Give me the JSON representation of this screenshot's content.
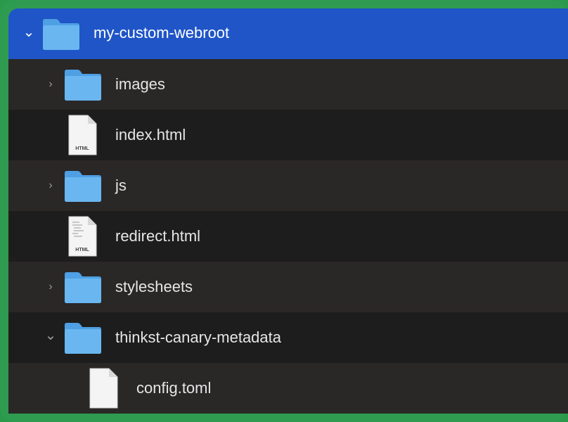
{
  "colors": {
    "frame": "#2f9b50",
    "panel": "#1e1d1d",
    "stripe": "#2a2727",
    "selected": "#1f55c7",
    "folder": "#5aa8e8",
    "text": "#e6e6e6"
  },
  "tree": {
    "root": {
      "name": "my-custom-webroot",
      "expanded": true,
      "selected": true,
      "icon": "folder-icon"
    },
    "items": [
      {
        "name": "images",
        "type": "folder",
        "icon": "folder-icon",
        "expanded": false
      },
      {
        "name": "index.html",
        "type": "file",
        "icon": "html-file-icon",
        "badge": "HTML"
      },
      {
        "name": "js",
        "type": "folder",
        "icon": "folder-icon",
        "expanded": false
      },
      {
        "name": "redirect.html",
        "type": "file",
        "icon": "html-file-icon",
        "badge": "HTML"
      },
      {
        "name": "stylesheets",
        "type": "folder",
        "icon": "folder-icon",
        "expanded": false
      },
      {
        "name": "thinkst-canary-metadata",
        "type": "folder",
        "icon": "folder-icon",
        "expanded": true
      },
      {
        "name": "config.toml",
        "type": "file",
        "icon": "document-icon"
      }
    ]
  },
  "glyphs": {
    "collapsed": "›",
    "expanded": "⌄"
  }
}
